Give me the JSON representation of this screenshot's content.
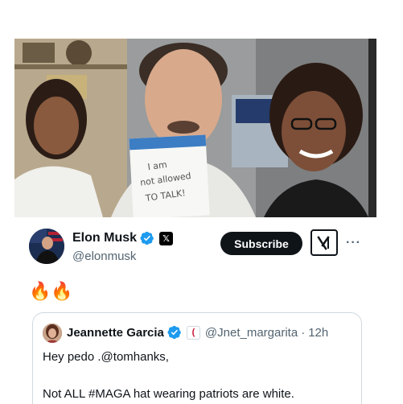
{
  "colors": {
    "verified_blue": "#1d9bf0",
    "text_primary": "#0f1419",
    "text_secondary": "#536471",
    "border": "#cfd9de"
  },
  "media": {
    "icon": "photo",
    "note_text": [
      "I am",
      "not allowed",
      "TO TALK!"
    ]
  },
  "post": {
    "author": {
      "display_name": "Elon Musk",
      "handle": "@elonmusk",
      "verified_icon": "verified-badge-icon",
      "affiliation_icon": "x-logo-icon"
    },
    "subscribe_label": "Subscribe",
    "grok_icon": "grok-icon",
    "more_label": "···",
    "body": "🔥🔥"
  },
  "quote": {
    "author": {
      "display_name": "Jeannette Garcia",
      "handle": "@Jnet_margarita",
      "separator": "·",
      "time": "12h",
      "verified_icon": "verified-badge-icon",
      "affiliation_icon": "affiliation-badge-icon"
    },
    "lines": [
      "Hey pedo .@tomhanks,",
      "Not ALL #MAGA hat wearing patriots are white."
    ]
  }
}
